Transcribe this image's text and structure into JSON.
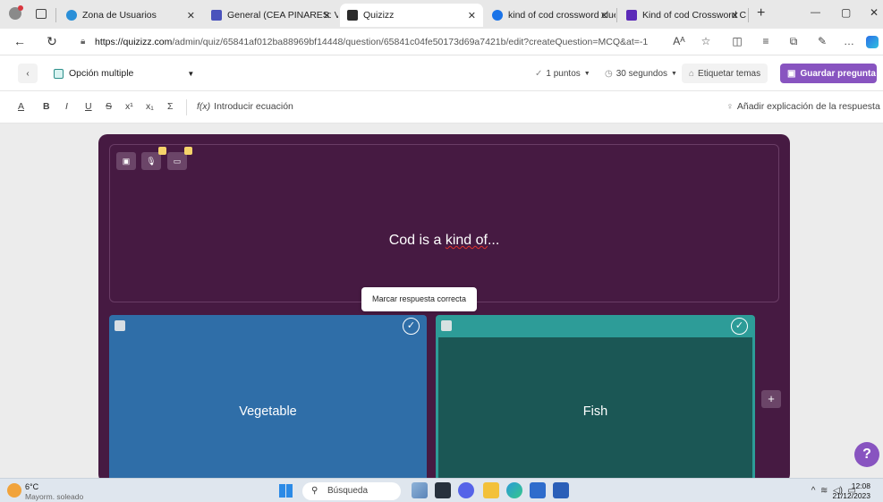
{
  "browser": {
    "tabs": [
      {
        "label": "Zona de Usuarios",
        "favicon_color": "#2a8fd8"
      },
      {
        "label": "General (CEA PINARES: VÍDE",
        "favicon_color": "#4b53bc"
      },
      {
        "label": "Quizizz",
        "favicon_color": "#2b2b2b"
      },
      {
        "label": "kind of cod crossword clue",
        "favicon_color": "#1a73e8"
      },
      {
        "label": "Kind of cod Crossword Clue",
        "favicon_color": "#5b2ab8"
      }
    ],
    "new_tab": "+",
    "window_controls": {
      "minimize": "—",
      "restore": "▢",
      "close": "✕"
    },
    "url_host": "https://quizizz.com",
    "url_path": "/admin/quiz/65841af012ba88969bf14448/question/65841c04fe50173d69a7421b/edit?createQuestion=MCQ&at=-1"
  },
  "editor_header": {
    "question_type": "Opción multiple",
    "points": "1 puntos",
    "time": "30 segundos",
    "tag_topics": "Etiquetar temas",
    "save": "Guardar pregunta"
  },
  "format_toolbar": {
    "buttons": [
      "A",
      "B",
      "I",
      "U",
      "S",
      "x¹",
      "x₁",
      "Σ"
    ],
    "equation": "Introducir ecuación",
    "explanation": "Añadir explicación de la respuesta"
  },
  "question": {
    "text_prefix": "Cod is a ",
    "text_misspelled": "kind of",
    "text_suffix": "...",
    "tooltip": "Marcar respuesta correcta"
  },
  "options": [
    {
      "text": "Vegetable",
      "color": "#2f6ea8"
    },
    {
      "text": "Fish",
      "color": "#2d9c98"
    }
  ],
  "help_label": "?",
  "add_option_label": "+",
  "taskbar": {
    "temp": "6°C",
    "weather": "Mayorm. soleado",
    "search_placeholder": "Búsqueda",
    "time": "12:08",
    "date": "21/12/2023"
  }
}
